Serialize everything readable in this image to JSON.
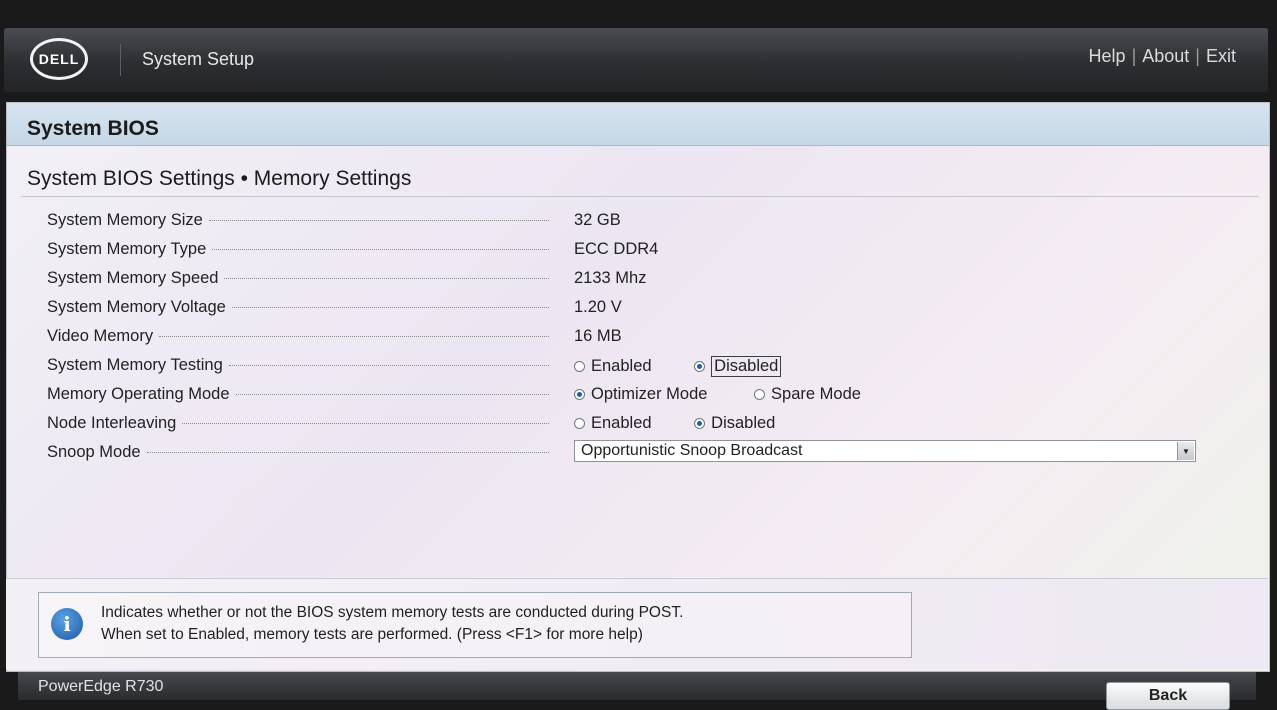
{
  "header": {
    "logo_text": "DELL",
    "app_title": "System Setup",
    "links": [
      "Help",
      "About",
      "Exit"
    ]
  },
  "panel": {
    "title": "System BIOS",
    "section_title": "System BIOS Settings • Memory Settings"
  },
  "settings": {
    "memory_size": {
      "label": "System Memory Size",
      "value": "32 GB"
    },
    "memory_type": {
      "label": "System Memory Type",
      "value": "ECC DDR4"
    },
    "memory_speed": {
      "label": "System Memory Speed",
      "value": "2133 Mhz"
    },
    "memory_voltage": {
      "label": "System Memory Voltage",
      "value": "1.20 V"
    },
    "video_memory": {
      "label": "Video Memory",
      "value": "16 MB"
    },
    "memory_testing": {
      "label": "System Memory Testing",
      "options": [
        "Enabled",
        "Disabled"
      ],
      "selected": "Disabled"
    },
    "operating_mode": {
      "label": "Memory Operating Mode",
      "options": [
        "Optimizer Mode",
        "Spare Mode"
      ],
      "selected": "Optimizer Mode"
    },
    "node_interleaving": {
      "label": "Node Interleaving",
      "options": [
        "Enabled",
        "Disabled"
      ],
      "selected": "Disabled"
    },
    "snoop_mode": {
      "label": "Snoop Mode",
      "value": "Opportunistic Snoop Broadcast"
    }
  },
  "help": {
    "icon": "info-icon",
    "line1": "Indicates whether or not the BIOS system memory tests are conducted during POST.",
    "line2": "When set to Enabled, memory tests are performed. (Press <F1> for more help)"
  },
  "footer": {
    "model": "PowerEdge R730",
    "back_label": "Back"
  }
}
